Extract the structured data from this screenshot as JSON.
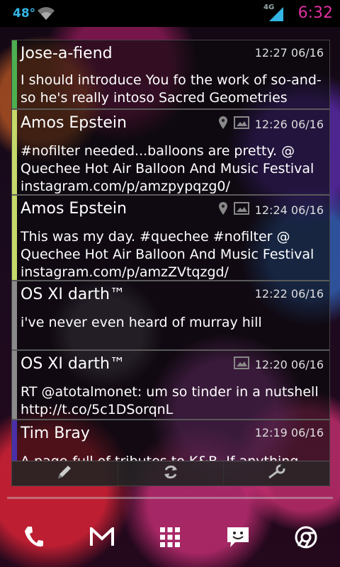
{
  "status_bar": {
    "temperature": "48°",
    "network": "4G",
    "time": "6:32",
    "icons": [
      "wifi-icon",
      "signal-icon"
    ]
  },
  "tweets": [
    {
      "author": "Jose-a-fiend",
      "timestamp": "12:27 06/16",
      "text": "I should introduce You fo the work of so-and-so he's really intoso Sacred Geometries",
      "accent_color": "#4caf50",
      "has_location": false,
      "has_image": false
    },
    {
      "author": "Amos Epstein",
      "timestamp": "12:26 06/16",
      "text": "#nofilter needed...balloons are pretty. @ Quechee Hot Air Balloon And Music Festival instagram.com/p/amzpypqzg0/",
      "accent_color": "#c5d96a",
      "has_location": true,
      "has_image": true
    },
    {
      "author": "Amos Epstein",
      "timestamp": "12:24 06/16",
      "text": "This was my day. #quechee #nofilter @ Quechee Hot Air Balloon And Music Festival instagram.com/p/amzZVtqzgd/",
      "accent_color": "#c5d96a",
      "has_location": true,
      "has_image": true
    },
    {
      "author": "OS XI darth™",
      "timestamp": "12:22 06/16",
      "text": "i've never even heard of murray hill",
      "accent_color": "#8a8a8a",
      "has_location": false,
      "has_image": false
    },
    {
      "author": "OS XI darth™",
      "timestamp": "12:20 06/16",
      "text": "RT @atotalmonet: um so tinder in a nutshell http://t.co/5c1DSorqnL",
      "accent_color": "#8a8a8a",
      "has_location": false,
      "has_image": true
    },
    {
      "author": "Tim Bray",
      "timestamp": "12:19 06/16",
      "text": "A page-full of tributes to K&B. If anything, they",
      "accent_color": "#4a2fa8",
      "has_location": false,
      "has_image": false
    }
  ],
  "toolbar": {
    "buttons": [
      "compose-icon",
      "refresh-icon",
      "settings-wrench-icon"
    ]
  },
  "dock": {
    "apps": [
      "phone-icon",
      "gmail-icon",
      "app-drawer-icon",
      "messaging-icon",
      "chrome-icon"
    ]
  }
}
